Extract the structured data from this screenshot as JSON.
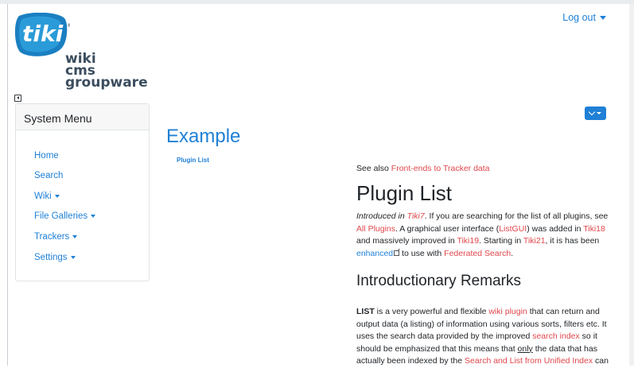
{
  "header": {
    "logo_text": [
      "wiki",
      "cms",
      "groupware"
    ],
    "logo_word": "tiki",
    "logout_label": "Log out"
  },
  "sidebar": {
    "title": "System Menu",
    "items": [
      {
        "label": "Home",
        "dropdown": false
      },
      {
        "label": "Search",
        "dropdown": false
      },
      {
        "label": "Wiki",
        "dropdown": true
      },
      {
        "label": "File Galleries",
        "dropdown": true
      },
      {
        "label": "Trackers",
        "dropdown": true
      },
      {
        "label": "Settings",
        "dropdown": true
      }
    ]
  },
  "example": {
    "title": "Example",
    "link": "Plugin List"
  },
  "article": {
    "see_also_prefix": "See also ",
    "see_also_link": "Front-ends to Tracker data",
    "title": "Plugin List",
    "intro": {
      "introduced_text": "Introduced in ",
      "introduced_link": "Tiki7",
      "t1": ". If you are searching for the list of all plugins, see ",
      "all_plugins": "All Plugins",
      "t2": ". A graphical user interface (",
      "listgui": "ListGUI",
      "t3": ") was added in ",
      "tiki18": "Tiki18",
      "t4": " and massively improved in ",
      "tiki19": "Tiki19",
      "t5": ". Starting in ",
      "tiki21": "Tiki21",
      "t6": ", it is has been ",
      "enhanced": "enhanced",
      "t7": " to use with ",
      "federated": "Federated Search",
      "t8": "."
    },
    "remarks_title": "Introductionary Remarks",
    "remarks": {
      "bold": "LIST",
      "t1": " is a very powerful and flexible ",
      "wiki_plugin": "wiki plugin",
      "t2": " that can return and output data (a listing) of information using various sorts, filters etc. It uses the search data provided by the improved ",
      "search_index": "search index",
      "t3": " so it should be emphasized that this means that ",
      "only": "only",
      "t4": " the data that has actually been indexed by the ",
      "search_link": "Search and List from Unified Index",
      "t5": " can"
    }
  },
  "colors": {
    "accent": "#1f80d6",
    "link": "#e0474c"
  }
}
